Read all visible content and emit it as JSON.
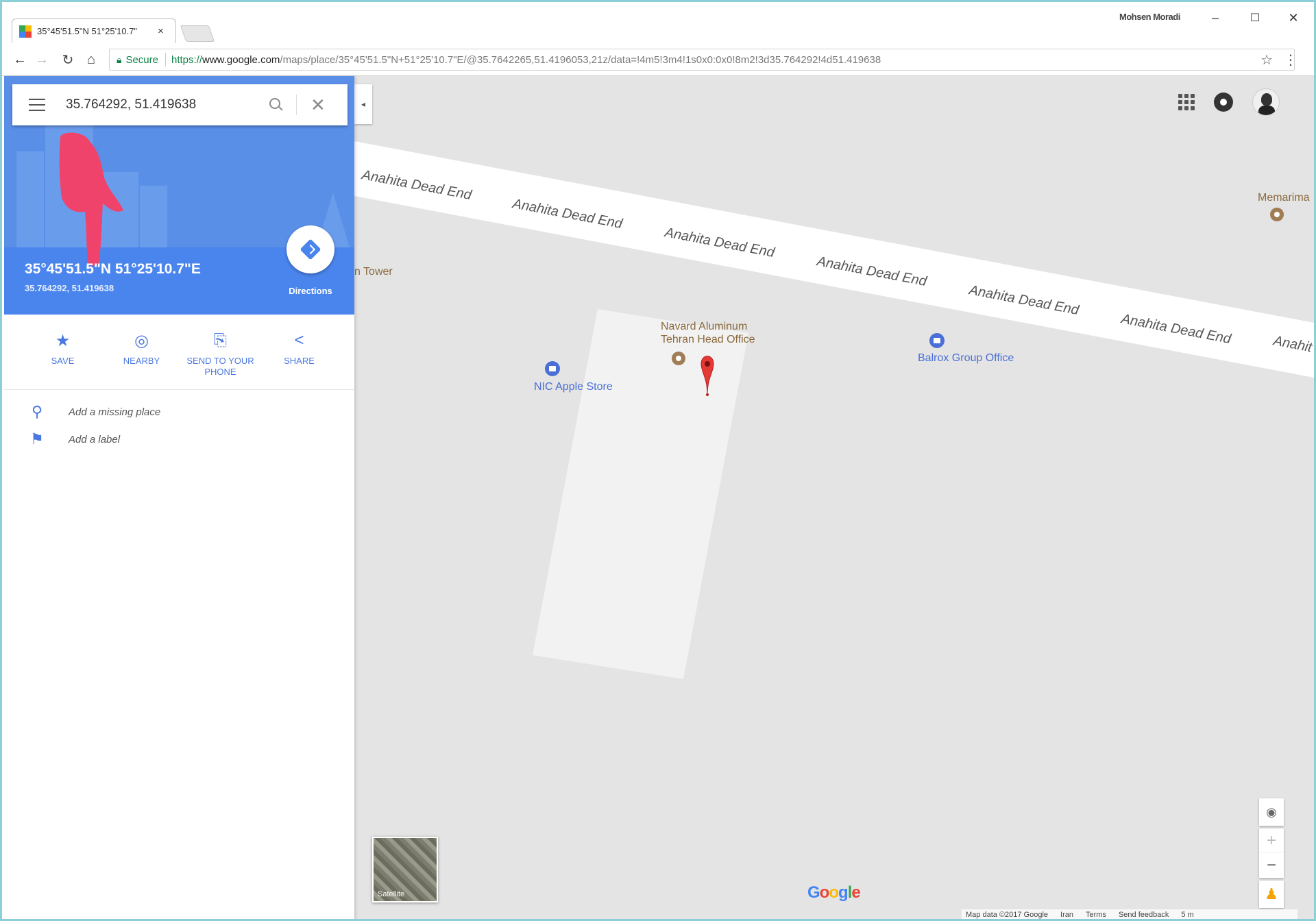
{
  "browser": {
    "tab_title": "35°45'51.5\"N 51°25'10.7\"",
    "tab_close": "×",
    "profile_name": "Mohsen Moradi",
    "window_controls": {
      "minimize": "–",
      "maximize": "☐",
      "close": "✕"
    },
    "back": "←",
    "forward": "→",
    "reload": "↻",
    "home": "⌂",
    "secure_label": "Secure",
    "url_scheme": "https://",
    "url_host": "www.google.com",
    "url_rest": "/maps/place/35°45'51.5\"N+51°25'10.7\"E/@35.7642265,51.4196053,21z/data=!4m5!3m4!1s0x0:0x0!8m2!3d35.764292!4d51.419638",
    "bookmark_star": "☆",
    "menu_kebab": "⋮"
  },
  "search": {
    "value": "35.764292, 51.419638",
    "close": "✕"
  },
  "place": {
    "title": "35°45'51.5\"N 51°25'10.7\"E",
    "subtitle": "35.764292, 51.419638",
    "directions_label": "Directions"
  },
  "actions": [
    {
      "label": "SAVE",
      "icon": "star-icon",
      "glyph": "★"
    },
    {
      "label": "NEARBY",
      "icon": "nearby-icon",
      "glyph": "◎"
    },
    {
      "label": "SEND TO YOUR PHONE",
      "icon": "send-to-phone-icon",
      "glyph": "⎘"
    },
    {
      "label": "SHARE",
      "icon": "share-icon",
      "glyph": "<"
    }
  ],
  "list": [
    {
      "label": "Add a missing place",
      "icon": "add-place-icon",
      "glyph": "⚲"
    },
    {
      "label": "Add a label",
      "icon": "flag-icon",
      "glyph": "⚑"
    }
  ],
  "map": {
    "road_name": "Anahita Dead End",
    "poi_navard_line1": "Navard Aluminum",
    "poi_navard_line2": "Tehran Head Office",
    "poi_nic": "NIC Apple Store",
    "poi_balrox": "Balrox Group Office",
    "poi_tower": "n Tower",
    "poi_memarima": "Memarima",
    "road_fragment": "Anahit",
    "collapse_arrow": "◂",
    "satellite_label": "Satellite",
    "zoom_in": "+",
    "zoom_out": "−",
    "locate": "◉",
    "pegman": "♟",
    "google_logo": [
      "G",
      "o",
      "o",
      "g",
      "l",
      "e"
    ],
    "footer": {
      "map_data": "Map data ©2017 Google",
      "region": "Iran",
      "terms": "Terms",
      "feedback": "Send feedback",
      "scale": "5 m"
    }
  },
  "colors": {
    "accent_blue": "#4a85ee",
    "pin_red": "#e53935",
    "logo": [
      "#4285f4",
      "#ea4335",
      "#fbbc05",
      "#4285f4",
      "#34a853",
      "#ea4335"
    ]
  }
}
